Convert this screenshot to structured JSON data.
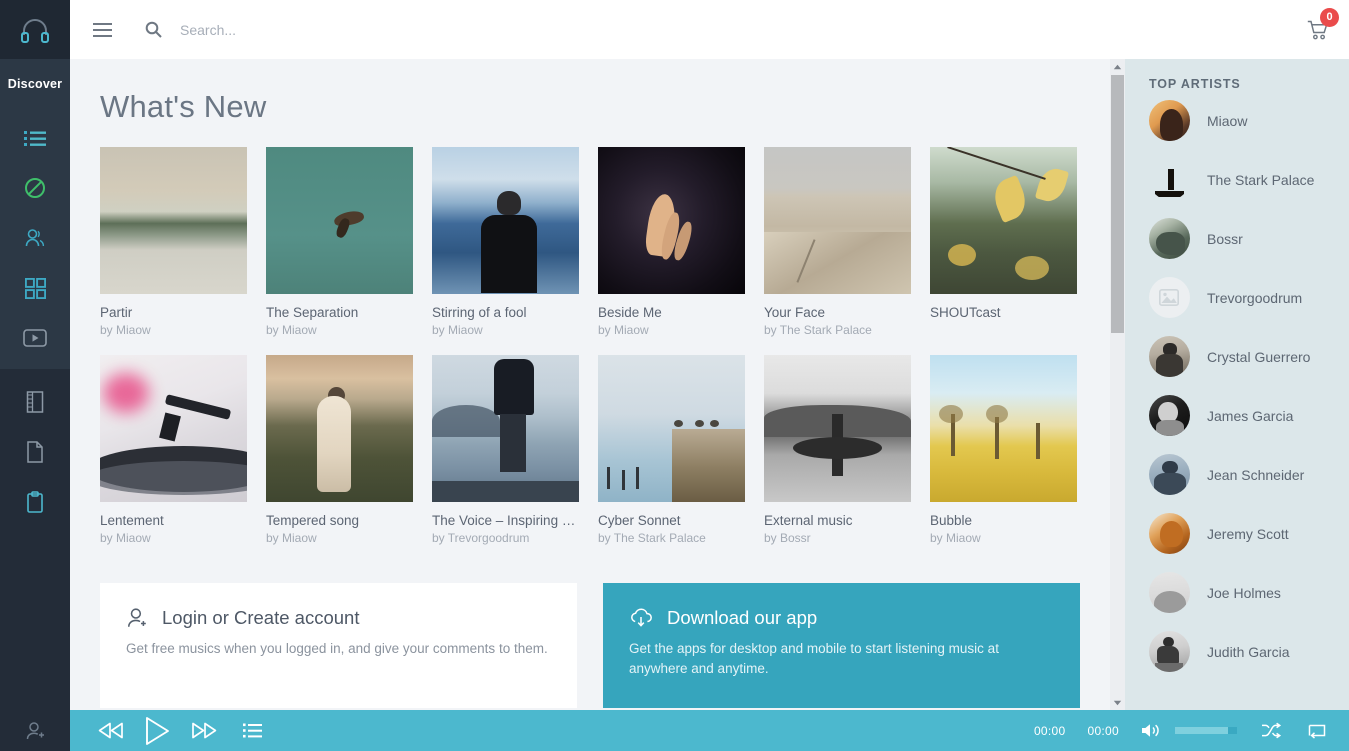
{
  "topbar": {
    "menu_icon": "hamburger-icon",
    "search_icon": "search-icon",
    "search_placeholder": "Search...",
    "search_value": "",
    "cart_icon": "shopping-cart-icon",
    "cart_count": "0",
    "cart_badge_color": "#ea4b4b"
  },
  "rail": {
    "logo_icon": "headphones-icon",
    "active_label": "Discover",
    "items": [
      {
        "icon": "list-icon",
        "color": "#3da9c4"
      },
      {
        "icon": "no-entry-icon",
        "color": "#3fbf6a"
      },
      {
        "icon": "user-group-icon",
        "color": "#3da9c4"
      },
      {
        "icon": "grid-squares-icon",
        "color": "#3da9c4"
      },
      {
        "icon": "video-play-icon",
        "color": "#8d99a6"
      },
      {
        "icon": "notebook-icon",
        "color": "#8d99a6"
      },
      {
        "icon": "file-icon",
        "color": "#8d99a6"
      },
      {
        "icon": "clipboard-icon",
        "color": "#4cb8ce"
      }
    ],
    "bottom_icon": "add-user-icon"
  },
  "main": {
    "title": "What's New",
    "cards": [
      {
        "title": "Partir",
        "by": "by Miaow",
        "art": "lake-fog"
      },
      {
        "title": "The Separation",
        "by": "by Miaow",
        "art": "bird-teal"
      },
      {
        "title": "Stirring of a fool",
        "by": "by Miaow",
        "art": "man-mountains"
      },
      {
        "title": "Beside Me",
        "by": "by Miaow",
        "art": "hand-dark"
      },
      {
        "title": "Your Face",
        "by": "by The Stark Palace",
        "art": "sand-dunes"
      },
      {
        "title": "SHOUTcast",
        "by": "",
        "art": "yellow-leaves"
      },
      {
        "title": "Lentement",
        "by": "by Miaow",
        "art": "turntable"
      },
      {
        "title": "Tempered song",
        "by": "by Miaow",
        "art": "robed-figure"
      },
      {
        "title": "The Voice – Inspiring &…",
        "by": "by Trevorgoodrum",
        "art": "man-misty-lake"
      },
      {
        "title": "Cyber Sonnet",
        "by": "by The Stark Palace",
        "art": "birds-wall"
      },
      {
        "title": "External music",
        "by": "by Bossr",
        "art": "surfer-bw"
      },
      {
        "title": "Bubble",
        "by": "by Miaow",
        "art": "golden-field"
      }
    ]
  },
  "promos": {
    "login": {
      "icon": "add-user-icon",
      "title": "Login or Create account",
      "body": "Get free musics when you logged in, and give your comments to them."
    },
    "app": {
      "icon": "cloud-download-icon",
      "title": "Download our app",
      "body": "Get the apps for desktop and mobile to start listening music at anywhere and anytime.",
      "bg_color": "#36a5bd"
    }
  },
  "right_panel": {
    "title": "TOP ARTISTS",
    "bg_color": "#dce7ea",
    "artists": [
      {
        "name": "Miaow",
        "avatar": "sunset-woman"
      },
      {
        "name": "The Stark Palace",
        "avatar": "silhouette-dusk"
      },
      {
        "name": "Bossr",
        "avatar": "green-figure"
      },
      {
        "name": "Trevorgoodrum",
        "avatar": "image-placeholder"
      },
      {
        "name": "Crystal Guerrero",
        "avatar": "man-back-grey"
      },
      {
        "name": "James Garcia",
        "avatar": "singer-bw"
      },
      {
        "name": "Jean Schneider",
        "avatar": "blue-back"
      },
      {
        "name": "Jeremy Scott",
        "avatar": "orange-portrait"
      },
      {
        "name": "Joe Holmes",
        "avatar": "grey-soft"
      },
      {
        "name": "Judith Garcia",
        "avatar": "sitting-bw"
      }
    ]
  },
  "player": {
    "bg_color": "#4cb8ce",
    "prev_icon": "rewind-icon",
    "play_icon": "play-icon",
    "next_icon": "fast-forward-icon",
    "playlist_icon": "playlist-icon",
    "elapsed": "00:00",
    "total": "00:00",
    "volume_icon": "volume-icon",
    "shuffle_icon": "shuffle-icon",
    "repeat_icon": "repeat-icon"
  },
  "scrollbar": {
    "up_icon": "caret-up-icon",
    "down_icon": "caret-down-icon"
  }
}
